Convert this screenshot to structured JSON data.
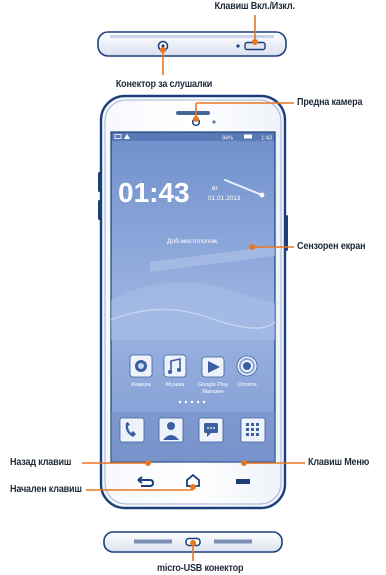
{
  "labels": {
    "power_key": "Клавиш Вкл./Изкл.",
    "headset": "Конектор за слушалки",
    "front_camera": "Предна камера",
    "touchscreen": "Сензорен екран",
    "back_key": "Назад клавиш",
    "home_key": "Начален клавиш",
    "menu_key": "Клавиш Меню",
    "usb": "micro-USB конектор"
  },
  "screen": {
    "battery": "94%",
    "status_time": "1:43",
    "clock": "01:43",
    "weekday": "вт",
    "date": "01.01.2013",
    "location_hint": "Доб.местополож.",
    "apps": [
      {
        "name": "Камера",
        "icon": "camera-icon"
      },
      {
        "name": "Музика",
        "icon": "music-icon"
      },
      {
        "name": "Google Play Магазин",
        "line1": "Google Play",
        "line2": "Магазин",
        "icon": "play-store-icon"
      },
      {
        "name": "Chrome",
        "icon": "chrome-icon"
      }
    ],
    "dock": [
      {
        "icon": "phone-icon"
      },
      {
        "icon": "contacts-icon"
      },
      {
        "icon": "messages-icon"
      },
      {
        "icon": "app-drawer-icon"
      }
    ]
  },
  "colors": {
    "accent": "#e87722",
    "phone_outline": "#1c3f7a",
    "screen_blue": "#7f9fd6"
  }
}
